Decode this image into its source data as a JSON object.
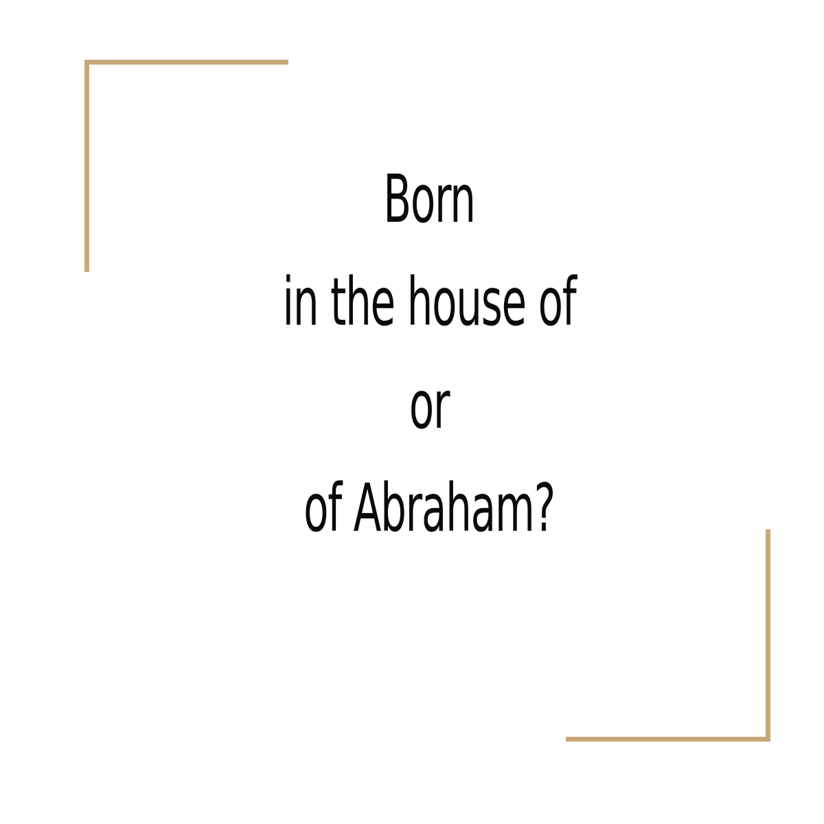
{
  "accent_color": "#c8a878",
  "text_color": "#0a0a0a",
  "background_color": "#ffffff",
  "lines": [
    "Born",
    "in the house of",
    "or",
    "of Abraham?"
  ]
}
